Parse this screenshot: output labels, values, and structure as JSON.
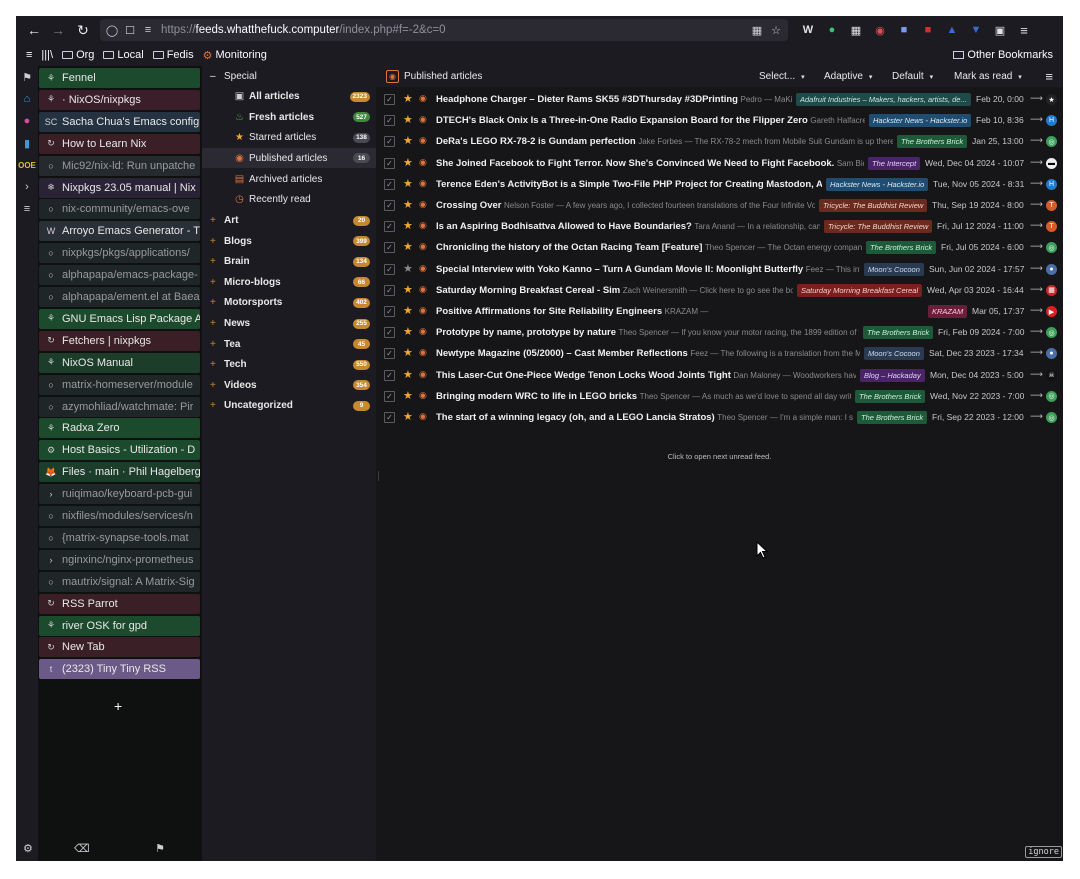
{
  "browser": {
    "url_prefix": "https://",
    "url_host": "feeds.whatthefuck.computer",
    "url_path": "/index.php#f=-2&c=0"
  },
  "bookmarks": {
    "items": [
      "Org",
      "Local",
      "Fedis",
      "Monitoring"
    ],
    "other": "Other Bookmarks"
  },
  "tabs": [
    {
      "label": "Fennel",
      "bg": "#1c4a2c",
      "fav": "⚘",
      "dim": false
    },
    {
      "label": "· NixOS/nixpkgs",
      "bg": "#3a1f2b",
      "fav": "⚘",
      "dim": false
    },
    {
      "label": "Sacha Chua's Emacs config",
      "bg": "#253241",
      "fav": "SC",
      "dim": false
    },
    {
      "label": "How to Learn Nix",
      "bg": "#3a1f26",
      "fav": "↻",
      "dim": false
    },
    {
      "label": "Mic92/nix-ld: Run unpatche",
      "bg": "#252a2e",
      "fav": "○",
      "dim": true
    },
    {
      "label": "Nixpkgs 23.05 manual | Nix",
      "bg": "#2a2235",
      "fav": "❄",
      "dim": false
    },
    {
      "label": "nix-community/emacs-ove",
      "bg": "#1f2628",
      "fav": "○",
      "dim": true
    },
    {
      "label": "Arroyo Emacs Generator - T",
      "bg": "#2a3037",
      "fav": "W",
      "dim": false
    },
    {
      "label": "nixpkgs/pkgs/applications/",
      "bg": "#1f2628",
      "fav": "○",
      "dim": true
    },
    {
      "label": "alphapapa/emacs-package-",
      "bg": "#1f2628",
      "fav": "○",
      "dim": true
    },
    {
      "label": "alphapapa/ement.el at Baea",
      "bg": "#1f2628",
      "fav": "○",
      "dim": true
    },
    {
      "label": "GNU Emacs Lisp Package Ar",
      "bg": "#1c4a2c",
      "fav": "⚘",
      "dim": false
    },
    {
      "label": "Fetchers | nixpkgs",
      "bg": "#3a1f26",
      "fav": "↻",
      "dim": false
    },
    {
      "label": "NixOS Manual",
      "bg": "#1c3d2a",
      "fav": "⚘",
      "dim": false
    },
    {
      "label": "matrix-homeserver/module",
      "bg": "#1f2628",
      "fav": "○",
      "dim": true
    },
    {
      "label": "azymohliad/watchmate: Pir",
      "bg": "#1f2628",
      "fav": "○",
      "dim": true
    },
    {
      "label": "Radxa Zero",
      "bg": "#1c4a2c",
      "fav": "⚘",
      "dim": false
    },
    {
      "label": "Host Basics - Utilization - D",
      "bg": "#1c4a2c",
      "fav": "⚙",
      "dim": false
    },
    {
      "label": "Files · main · Phil Hagelberg",
      "bg": "#1c3d2a",
      "fav": "🦊",
      "dim": false
    },
    {
      "label": "ruiqimao/keyboard-pcb-gui",
      "bg": "#1f2628",
      "fav": "›",
      "dim": true
    },
    {
      "label": "nixfiles/modules/services/n",
      "bg": "#1f2628",
      "fav": "○",
      "dim": true
    },
    {
      "label": "{matrix-synapse-tools.mat",
      "bg": "#1f2628",
      "fav": "○",
      "dim": true
    },
    {
      "label": "nginxinc/nginx-prometheus",
      "bg": "#1f2628",
      "fav": "›",
      "dim": true
    },
    {
      "label": "mautrix/signal: A Matrix-Sig",
      "bg": "#1f2628",
      "fav": "○",
      "dim": true
    },
    {
      "label": "RSS Parrot",
      "bg": "#3a1f26",
      "fav": "↻",
      "dim": false
    },
    {
      "label": "river OSK for gpd",
      "bg": "#1c4a2c",
      "fav": "⚘",
      "dim": false
    },
    {
      "label": "New Tab",
      "bg": "#3a1f26",
      "fav": "↻",
      "dim": false
    },
    {
      "label": "(2323) Tiny Tiny RSS",
      "bg": "#6b5a87",
      "fav": "t",
      "dim": false
    }
  ],
  "tree": {
    "special_label": "Special",
    "special": [
      {
        "label": "All articles",
        "count": "2323",
        "bold": true,
        "badge": "orange",
        "icon": "▣",
        "icon_color": "#cfcfcf"
      },
      {
        "label": "Fresh articles",
        "count": "527",
        "bold": true,
        "badge": "green",
        "icon": "♨",
        "icon_color": "#5ab947"
      },
      {
        "label": "Starred articles",
        "count": "138",
        "bold": false,
        "badge": "gray",
        "icon": "★",
        "icon_color": "#f0a830"
      },
      {
        "label": "Published articles",
        "count": "16",
        "bold": false,
        "badge": "gray",
        "icon": "◉",
        "icon_color": "#e0733a",
        "selected": true
      },
      {
        "label": "Archived articles",
        "count": "",
        "bold": false,
        "badge": "",
        "icon": "▤",
        "icon_color": "#e0733a"
      },
      {
        "label": "Recently read",
        "count": "",
        "bold": false,
        "badge": "",
        "icon": "◷",
        "icon_color": "#e0733a"
      }
    ],
    "categories": [
      {
        "label": "Art",
        "count": "20"
      },
      {
        "label": "Blogs",
        "count": "399"
      },
      {
        "label": "Brain",
        "count": "134"
      },
      {
        "label": "Micro-blogs",
        "count": "66"
      },
      {
        "label": "Motorsports",
        "count": "402"
      },
      {
        "label": "News",
        "count": "255"
      },
      {
        "label": "Tea",
        "count": "45"
      },
      {
        "label": "Tech",
        "count": "550"
      },
      {
        "label": "Videos",
        "count": "354"
      },
      {
        "label": "Uncategorized",
        "count": "9"
      }
    ]
  },
  "header": {
    "title": "Published articles",
    "select": "Select...",
    "adaptive": "Adaptive",
    "default": "Default",
    "mark_read": "Mark as read"
  },
  "articles": [
    {
      "title": "Headphone Charger – Dieter Rams SK55 #3DThursday #3DPrinting",
      "excerpt": "Pedro — MaKi...",
      "feed": "Adafruit Industries – Makers, hackers, artists, de...",
      "feed_bg": "#1e4a4a",
      "feed_fg": "#c8e8e0",
      "date": "Feb 20, 0:00",
      "fav": "★",
      "fav_bg": "#222",
      "fav_fg": "#fff"
    },
    {
      "title": "DTECH's Black Onix Is a Three-in-One Radio Expansion Board for the Flipper Zero",
      "excerpt": "Gareth Halfacree — ...",
      "feed": "Hackster News - Hackster.io",
      "feed_bg": "#1f4d72",
      "feed_fg": "#d8ecf8",
      "date": "Feb 10, 8:36",
      "fav": "H",
      "fav_bg": "#1f7bd1",
      "fav_fg": "#fff"
    },
    {
      "title": "DeRa's LEGO RX-78-2 is Gundam perfection",
      "excerpt": "Jake Forbes — The RX-78-2 mech from Mobile Suit Gundam is up there with...",
      "feed": "The Brothers Brick",
      "feed_bg": "#1d5a3a",
      "feed_fg": "#cdeed8",
      "date": "Jan 25, 13:00",
      "fav": "◎",
      "fav_bg": "#3aa05a",
      "fav_fg": "#fff"
    },
    {
      "title": "She Joined Facebook to Fight Terror. Now She's Convinced We Need to Fight Facebook.",
      "excerpt": "Sam Biddle —",
      "feed": "The Intercept",
      "feed_bg": "#4a2468",
      "feed_fg": "#e5d0f5",
      "date": "Wed, Dec 04 2024 - 10:07",
      "fav": "▬",
      "fav_bg": "#eee",
      "fav_fg": "#000"
    },
    {
      "title": "Terence Eden's ActivityBot is a Simple Two-File PHP Project for Creating Mastodon, Ac...",
      "excerpt": "",
      "feed": "Hackster News - Hackster.io",
      "feed_bg": "#1f4d72",
      "feed_fg": "#d8ecf8",
      "date": "Tue, Nov 05 2024 - 8:31",
      "fav": "H",
      "fav_bg": "#1f7bd1",
      "fav_fg": "#fff"
    },
    {
      "title": "Crossing Over",
      "excerpt": "Nelson Foster — A few years ago, I collected fourteen translations of the Four Infinite Vows, a ...",
      "feed": "Tricycle: The Buddhist Review",
      "feed_bg": "#6a2a1e",
      "feed_fg": "#f3d4c8",
      "date": "Thu, Sep 19 2024 - 8:00",
      "fav": "T",
      "fav_bg": "#d65a2a",
      "fav_fg": "#fff"
    },
    {
      "title": "Is an Aspiring Bodhisattva Allowed to Have Boundaries?",
      "excerpt": "Tara Anand — In a relationship, can one...",
      "feed": "Tricycle: The Buddhist Review",
      "feed_bg": "#6a2a1e",
      "feed_fg": "#f3d4c8",
      "date": "Fri, Jul 12 2024 - 11:00",
      "fav": "T",
      "fav_bg": "#d65a2a",
      "fav_fg": "#fff"
    },
    {
      "title": "Chronicling the history of the Octan Racing Team [Feature]",
      "excerpt": "Theo Spencer — The Octan energy company ho...",
      "feed": "The Brothers Brick",
      "feed_bg": "#1d5a3a",
      "feed_fg": "#cdeed8",
      "date": "Fri, Jul 05 2024 - 6:00",
      "fav": "◎",
      "fav_bg": "#3aa05a",
      "fav_fg": "#fff"
    },
    {
      "title": "Special Interview with Yoko Kanno – Turn A Gundam Movie II: Moonlight Butterfly",
      "excerpt": "Feez — This inter...",
      "feed": "Moon's Cocoon",
      "feed_bg": "#2a3a52",
      "feed_fg": "#d0dcee",
      "date": "Sun, Jun 02 2024 - 17:57",
      "fav": "●",
      "fav_bg": "#4a6ea8",
      "fav_fg": "#fff"
    },
    {
      "title": "Saturday Morning Breakfast Cereal - Sim",
      "excerpt": "Zach Weinersmith — Click here to go see the bonus...",
      "feed": "Saturday Morning Breakfast Cereal",
      "feed_bg": "#7a1e1e",
      "feed_fg": "#f5d0d0",
      "date": "Wed, Apr 03 2024 - 16:44",
      "fav": "▦",
      "fav_bg": "#c82828",
      "fav_fg": "#fff"
    },
    {
      "title": "Positive Affirmations for Site Reliability Engineers",
      "excerpt": "KRAZAM —",
      "feed": "KRAZAM",
      "feed_bg": "#6a1e3a",
      "feed_fg": "#f5cfe0",
      "date": "Mar 05, 17:37",
      "fav": "▶",
      "fav_bg": "#e02020",
      "fav_fg": "#fff"
    },
    {
      "title": "Prototype by name, prototype by nature",
      "excerpt": "Theo Spencer — If you know your motor racing, the 1899 edition of the ...",
      "feed": "The Brothers Brick",
      "feed_bg": "#1d5a3a",
      "feed_fg": "#cdeed8",
      "date": "Fri, Feb 09 2024 - 7:00",
      "fav": "◎",
      "fav_bg": "#3aa05a",
      "fav_fg": "#fff"
    },
    {
      "title": "Newtype Magazine (05/2000) – Cast Member Reflections",
      "excerpt": "Feez — The following is a translation from the Ma...",
      "feed": "Moon's Cocoon",
      "feed_bg": "#2a3a52",
      "feed_fg": "#d0dcee",
      "date": "Sat, Dec 23 2023 - 17:34",
      "fav": "●",
      "fav_bg": "#4a6ea8",
      "fav_fg": "#fff"
    },
    {
      "title": "This Laser-Cut One-Piece Wedge Tenon Locks Wood Joints Tight",
      "excerpt": "Dan Maloney — Woodworkers have alw...",
      "feed": "Blog – Hackaday",
      "feed_bg": "#4a2468",
      "feed_fg": "#e5d0f5",
      "date": "Mon, Dec 04 2023 - 5:00",
      "fav": "☠",
      "fav_bg": "#111",
      "fav_fg": "#fff"
    },
    {
      "title": "Bringing modern WRC to life in LEGO bricks",
      "excerpt": "Theo Spencer — As much as we'd love to spend all day writing ab...",
      "feed": "The Brothers Brick",
      "feed_bg": "#1d5a3a",
      "feed_fg": "#cdeed8",
      "date": "Wed, Nov 22 2023 - 7:00",
      "fav": "◎",
      "fav_bg": "#3aa05a",
      "fav_fg": "#fff"
    },
    {
      "title": "The start of a winning legacy (oh, and a LEGO Lancia Stratos)",
      "excerpt": "Theo Spencer — I'm a simple man: I see a ...",
      "feed": "The Brothers Brick",
      "feed_bg": "#1d5a3a",
      "feed_fg": "#cdeed8",
      "date": "Fri, Sep 22 2023 - 12:00",
      "fav": "◎",
      "fav_bg": "#3aa05a",
      "fav_fg": "#fff"
    }
  ],
  "footer": {
    "next_unread": "Click to open next unread feed.",
    "ignore": "ignore"
  }
}
